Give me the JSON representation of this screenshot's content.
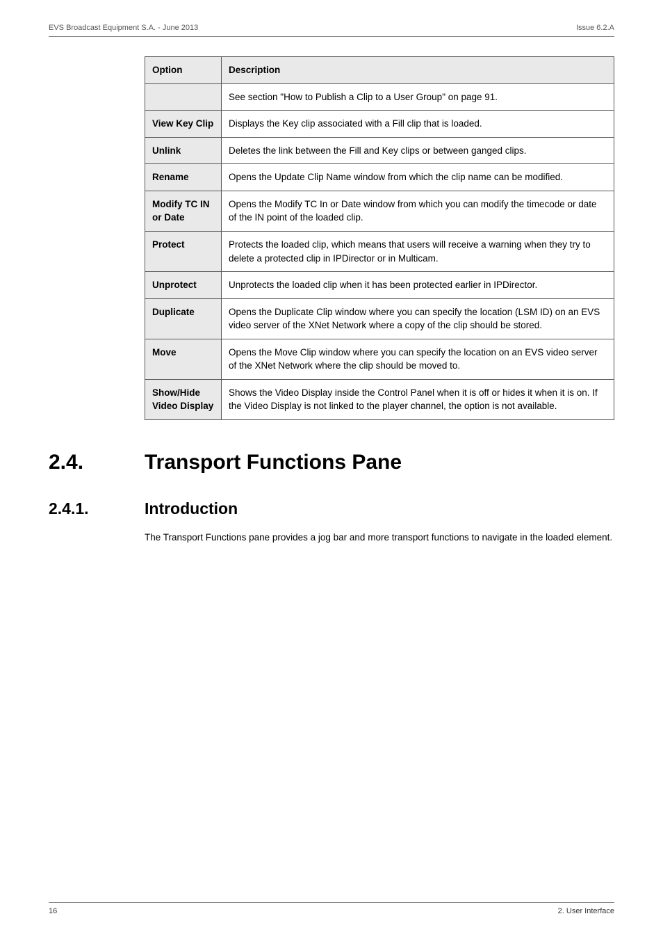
{
  "header": {
    "left": "EVS Broadcast Equipment S.A. - June 2013",
    "right": "Issue 6.2.A"
  },
  "table": {
    "head_option": "Option",
    "head_description": "Description",
    "rows": [
      {
        "option": "",
        "description": "See section \"How to Publish a Clip to a User Group\" on page 91."
      },
      {
        "option": "View Key Clip",
        "description": "Displays the Key clip associated with a Fill clip that is loaded."
      },
      {
        "option": "Unlink",
        "description": "Deletes the link between the Fill and Key clips or between ganged clips."
      },
      {
        "option": "Rename",
        "description": "Opens the Update Clip Name window from which the clip name can be modified."
      },
      {
        "option": "Modify TC IN or Date",
        "description": "Opens the Modify TC In or Date window from which you can modify the timecode or date of the IN point of the loaded clip."
      },
      {
        "option": "Protect",
        "description": "Protects the loaded clip, which means that users will receive a warning when they try to delete a protected clip in IPDirector or in Multicam."
      },
      {
        "option": "Unprotect",
        "description": "Unprotects the loaded clip when it has been protected earlier in IPDirector."
      },
      {
        "option": "Duplicate",
        "description": "Opens the Duplicate Clip window where you can specify the location (LSM ID) on an EVS video server of the XNet Network where a copy of the clip should be stored."
      },
      {
        "option": "Move",
        "description": "Opens the Move Clip window where you can specify the location on an EVS video server of the XNet Network where the clip should be moved to."
      },
      {
        "option": "Show/Hide Video Display",
        "description": "Shows the Video Display inside the Control Panel when it is off or hides it when it is on. If the Video Display is not linked to the player channel, the option is not available."
      }
    ]
  },
  "section": {
    "num": "2.4.",
    "title": "Transport Functions Pane"
  },
  "subsection": {
    "num": "2.4.1.",
    "title": "Introduction"
  },
  "paragraph": "The Transport Functions pane provides a jog bar and more transport functions to navigate in the loaded element.",
  "footer": {
    "left": "16",
    "right": "2. User Interface"
  }
}
